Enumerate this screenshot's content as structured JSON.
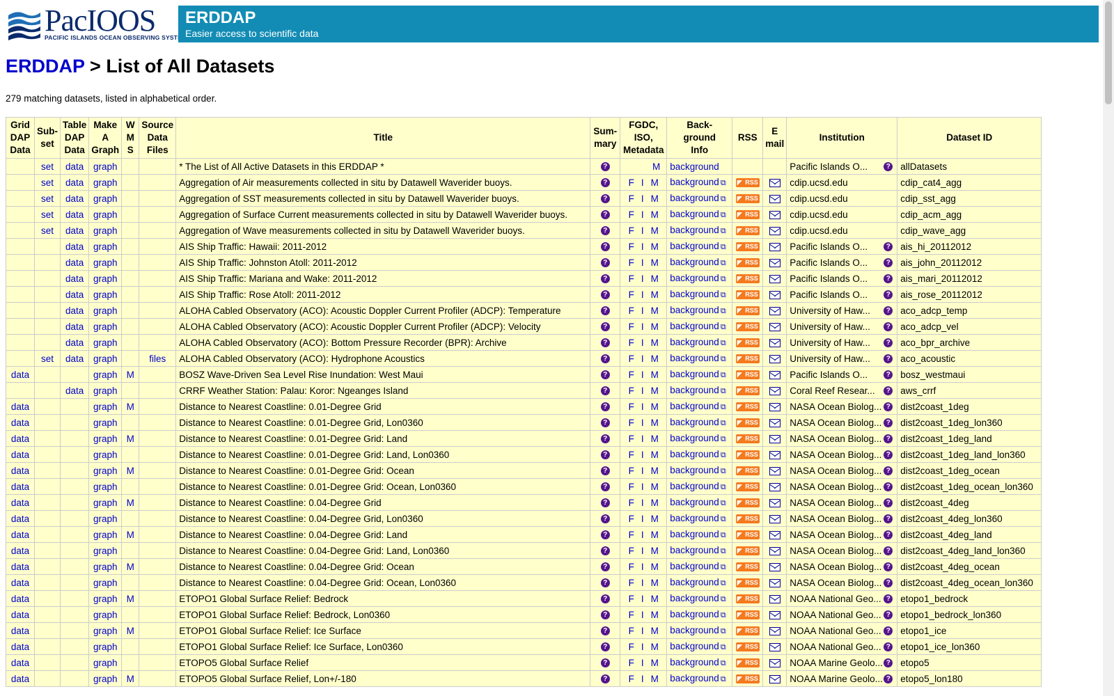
{
  "logo": {
    "name": "PacIOOS",
    "subtitle": "PACIFIC ISLANDS OCEAN OBSERVING SYSTEM"
  },
  "banner": {
    "title": "ERDDAP",
    "subtitle": "Easier access to scientific data"
  },
  "breadcrumb": {
    "home": "ERDDAP",
    "separator": " > ",
    "page": "List of All Datasets"
  },
  "count_text": "279 matching datasets, listed in alphabetical order.",
  "columns": {
    "griddap": [
      "Grid",
      "DAP",
      "Data"
    ],
    "subset": [
      "Sub-",
      "set"
    ],
    "tabledap": [
      "Table",
      "DAP",
      "Data"
    ],
    "graph": [
      "Make",
      "A",
      "Graph"
    ],
    "wms": [
      "W",
      "M",
      "S"
    ],
    "files": [
      "Source",
      "Data",
      "Files"
    ],
    "title": [
      "Title"
    ],
    "summary": [
      "Sum-",
      "mary"
    ],
    "metadata": [
      "FGDC,",
      "ISO,",
      "Metadata"
    ],
    "info": [
      "Back-",
      "ground",
      "Info"
    ],
    "rss": [
      "RSS"
    ],
    "email": [
      "E",
      "mail"
    ],
    "institution": [
      "Institution"
    ],
    "id": [
      "Dataset ID"
    ]
  },
  "rows": [
    {
      "grid": "",
      "subset": "set",
      "table": "data",
      "graph": "graph",
      "wms": "",
      "files": "",
      "title": "* The List of All Active Datasets in this ERDDAP *",
      "f": "",
      "i": "",
      "m": "M",
      "bg": "background",
      "ext": false,
      "rss": false,
      "mail": false,
      "inst": "Pacific Islands O...",
      "id": "allDatasets"
    },
    {
      "grid": "",
      "subset": "set",
      "table": "data",
      "graph": "graph",
      "wms": "",
      "files": "",
      "title": "Aggregation of Air measurements collected in situ by Datawell Waverider buoys.",
      "f": "F",
      "i": "I",
      "m": "M",
      "bg": "background",
      "ext": true,
      "rss": true,
      "mail": true,
      "inst": "cdip.ucsd.edu",
      "noq": true,
      "id": "cdip_cat4_agg"
    },
    {
      "grid": "",
      "subset": "set",
      "table": "data",
      "graph": "graph",
      "wms": "",
      "files": "",
      "title": "Aggregation of SST measurements collected in situ by Datawell Waverider buoys.",
      "f": "F",
      "i": "I",
      "m": "M",
      "bg": "background",
      "ext": true,
      "rss": true,
      "mail": true,
      "inst": "cdip.ucsd.edu",
      "noq": true,
      "id": "cdip_sst_agg"
    },
    {
      "grid": "",
      "subset": "set",
      "table": "data",
      "graph": "graph",
      "wms": "",
      "files": "",
      "title": "Aggregation of Surface Current measurements collected in situ by Datawell Waverider buoys.",
      "f": "F",
      "i": "I",
      "m": "M",
      "bg": "background",
      "ext": true,
      "rss": true,
      "mail": true,
      "inst": "cdip.ucsd.edu",
      "noq": true,
      "id": "cdip_acm_agg"
    },
    {
      "grid": "",
      "subset": "set",
      "table": "data",
      "graph": "graph",
      "wms": "",
      "files": "",
      "title": "Aggregation of Wave measurements collected in situ by Datawell Waverider buoys.",
      "f": "F",
      "i": "I",
      "m": "M",
      "bg": "background",
      "ext": true,
      "rss": true,
      "mail": true,
      "inst": "cdip.ucsd.edu",
      "noq": true,
      "id": "cdip_wave_agg"
    },
    {
      "grid": "",
      "subset": "",
      "table": "data",
      "graph": "graph",
      "wms": "",
      "files": "",
      "title": "AIS Ship Traffic: Hawaii: 2011-2012",
      "f": "F",
      "i": "I",
      "m": "M",
      "bg": "background",
      "ext": true,
      "rss": true,
      "mail": true,
      "inst": "Pacific Islands O...",
      "id": "ais_hi_20112012"
    },
    {
      "grid": "",
      "subset": "",
      "table": "data",
      "graph": "graph",
      "wms": "",
      "files": "",
      "title": "AIS Ship Traffic: Johnston Atoll: 2011-2012",
      "f": "F",
      "i": "I",
      "m": "M",
      "bg": "background",
      "ext": true,
      "rss": true,
      "mail": true,
      "inst": "Pacific Islands O...",
      "id": "ais_john_20112012"
    },
    {
      "grid": "",
      "subset": "",
      "table": "data",
      "graph": "graph",
      "wms": "",
      "files": "",
      "title": "AIS Ship Traffic: Mariana and Wake: 2011-2012",
      "f": "F",
      "i": "I",
      "m": "M",
      "bg": "background",
      "ext": true,
      "rss": true,
      "mail": true,
      "inst": "Pacific Islands O...",
      "id": "ais_mari_20112012"
    },
    {
      "grid": "",
      "subset": "",
      "table": "data",
      "graph": "graph",
      "wms": "",
      "files": "",
      "title": "AIS Ship Traffic: Rose Atoll: 2011-2012",
      "f": "F",
      "i": "I",
      "m": "M",
      "bg": "background",
      "ext": true,
      "rss": true,
      "mail": true,
      "inst": "Pacific Islands O...",
      "id": "ais_rose_20112012"
    },
    {
      "grid": "",
      "subset": "",
      "table": "data",
      "graph": "graph",
      "wms": "",
      "files": "",
      "title": "ALOHA Cabled Observatory (ACO): Acoustic Doppler Current Profiler (ADCP): Temperature",
      "f": "F",
      "i": "I",
      "m": "M",
      "bg": "background",
      "ext": true,
      "rss": true,
      "mail": true,
      "inst": "University of Haw...",
      "id": "aco_adcp_temp"
    },
    {
      "grid": "",
      "subset": "",
      "table": "data",
      "graph": "graph",
      "wms": "",
      "files": "",
      "title": "ALOHA Cabled Observatory (ACO): Acoustic Doppler Current Profiler (ADCP): Velocity",
      "f": "F",
      "i": "I",
      "m": "M",
      "bg": "background",
      "ext": true,
      "rss": true,
      "mail": true,
      "inst": "University of Haw...",
      "id": "aco_adcp_vel"
    },
    {
      "grid": "",
      "subset": "",
      "table": "data",
      "graph": "graph",
      "wms": "",
      "files": "",
      "title": "ALOHA Cabled Observatory (ACO): Bottom Pressure Recorder (BPR): Archive",
      "f": "F",
      "i": "I",
      "m": "M",
      "bg": "background",
      "ext": true,
      "rss": true,
      "mail": true,
      "inst": "University of Haw...",
      "id": "aco_bpr_archive"
    },
    {
      "grid": "",
      "subset": "set",
      "table": "data",
      "graph": "graph",
      "wms": "",
      "files": "files",
      "title": "ALOHA Cabled Observatory (ACO): Hydrophone Acoustics",
      "f": "F",
      "i": "I",
      "m": "M",
      "bg": "background",
      "ext": true,
      "rss": true,
      "mail": true,
      "inst": "University of Haw...",
      "id": "aco_acoustic"
    },
    {
      "grid": "data",
      "subset": "",
      "table": "",
      "graph": "graph",
      "wms": "M",
      "files": "",
      "title": "BOSZ Wave-Driven Sea Level Rise Inundation: West Maui",
      "f": "F",
      "i": "I",
      "m": "M",
      "bg": "background",
      "ext": true,
      "rss": true,
      "mail": true,
      "inst": "Pacific Islands O...",
      "id": "bosz_westmaui"
    },
    {
      "grid": "",
      "subset": "",
      "table": "data",
      "graph": "graph",
      "wms": "",
      "files": "",
      "title": "CRRF Weather Station: Palau: Koror: Ngeanges Island",
      "f": "F",
      "i": "I",
      "m": "M",
      "bg": "background",
      "ext": true,
      "rss": true,
      "mail": true,
      "inst": "Coral Reef Resear...",
      "id": "aws_crrf"
    },
    {
      "grid": "data",
      "subset": "",
      "table": "",
      "graph": "graph",
      "wms": "M",
      "files": "",
      "title": "Distance to Nearest Coastline: 0.01-Degree Grid",
      "f": "F",
      "i": "I",
      "m": "M",
      "bg": "background",
      "ext": true,
      "rss": true,
      "mail": true,
      "inst": "NASA Ocean Biolog...",
      "id": "dist2coast_1deg"
    },
    {
      "grid": "data",
      "subset": "",
      "table": "",
      "graph": "graph",
      "wms": "",
      "files": "",
      "title": "Distance to Nearest Coastline: 0.01-Degree Grid, Lon0360",
      "f": "F",
      "i": "I",
      "m": "M",
      "bg": "background",
      "ext": true,
      "rss": true,
      "mail": true,
      "inst": "NASA Ocean Biolog...",
      "id": "dist2coast_1deg_lon360"
    },
    {
      "grid": "data",
      "subset": "",
      "table": "",
      "graph": "graph",
      "wms": "M",
      "files": "",
      "title": "Distance to Nearest Coastline: 0.01-Degree Grid: Land",
      "f": "F",
      "i": "I",
      "m": "M",
      "bg": "background",
      "ext": true,
      "rss": true,
      "mail": true,
      "inst": "NASA Ocean Biolog...",
      "id": "dist2coast_1deg_land"
    },
    {
      "grid": "data",
      "subset": "",
      "table": "",
      "graph": "graph",
      "wms": "",
      "files": "",
      "title": "Distance to Nearest Coastline: 0.01-Degree Grid: Land, Lon0360",
      "f": "F",
      "i": "I",
      "m": "M",
      "bg": "background",
      "ext": true,
      "rss": true,
      "mail": true,
      "inst": "NASA Ocean Biolog...",
      "id": "dist2coast_1deg_land_lon360"
    },
    {
      "grid": "data",
      "subset": "",
      "table": "",
      "graph": "graph",
      "wms": "M",
      "files": "",
      "title": "Distance to Nearest Coastline: 0.01-Degree Grid: Ocean",
      "f": "F",
      "i": "I",
      "m": "M",
      "bg": "background",
      "ext": true,
      "rss": true,
      "mail": true,
      "inst": "NASA Ocean Biolog...",
      "id": "dist2coast_1deg_ocean"
    },
    {
      "grid": "data",
      "subset": "",
      "table": "",
      "graph": "graph",
      "wms": "",
      "files": "",
      "title": "Distance to Nearest Coastline: 0.01-Degree Grid: Ocean, Lon0360",
      "f": "F",
      "i": "I",
      "m": "M",
      "bg": "background",
      "ext": true,
      "rss": true,
      "mail": true,
      "inst": "NASA Ocean Biolog...",
      "id": "dist2coast_1deg_ocean_lon360"
    },
    {
      "grid": "data",
      "subset": "",
      "table": "",
      "graph": "graph",
      "wms": "M",
      "files": "",
      "title": "Distance to Nearest Coastline: 0.04-Degree Grid",
      "f": "F",
      "i": "I",
      "m": "M",
      "bg": "background",
      "ext": true,
      "rss": true,
      "mail": true,
      "inst": "NASA Ocean Biolog...",
      "id": "dist2coast_4deg"
    },
    {
      "grid": "data",
      "subset": "",
      "table": "",
      "graph": "graph",
      "wms": "",
      "files": "",
      "title": "Distance to Nearest Coastline: 0.04-Degree Grid, Lon0360",
      "f": "F",
      "i": "I",
      "m": "M",
      "bg": "background",
      "ext": true,
      "rss": true,
      "mail": true,
      "inst": "NASA Ocean Biolog...",
      "id": "dist2coast_4deg_lon360"
    },
    {
      "grid": "data",
      "subset": "",
      "table": "",
      "graph": "graph",
      "wms": "M",
      "files": "",
      "title": "Distance to Nearest Coastline: 0.04-Degree Grid: Land",
      "f": "F",
      "i": "I",
      "m": "M",
      "bg": "background",
      "ext": true,
      "rss": true,
      "mail": true,
      "inst": "NASA Ocean Biolog...",
      "id": "dist2coast_4deg_land"
    },
    {
      "grid": "data",
      "subset": "",
      "table": "",
      "graph": "graph",
      "wms": "",
      "files": "",
      "title": "Distance to Nearest Coastline: 0.04-Degree Grid: Land, Lon0360",
      "f": "F",
      "i": "I",
      "m": "M",
      "bg": "background",
      "ext": true,
      "rss": true,
      "mail": true,
      "inst": "NASA Ocean Biolog...",
      "id": "dist2coast_4deg_land_lon360"
    },
    {
      "grid": "data",
      "subset": "",
      "table": "",
      "graph": "graph",
      "wms": "M",
      "files": "",
      "title": "Distance to Nearest Coastline: 0.04-Degree Grid: Ocean",
      "f": "F",
      "i": "I",
      "m": "M",
      "bg": "background",
      "ext": true,
      "rss": true,
      "mail": true,
      "inst": "NASA Ocean Biolog...",
      "id": "dist2coast_4deg_ocean"
    },
    {
      "grid": "data",
      "subset": "",
      "table": "",
      "graph": "graph",
      "wms": "",
      "files": "",
      "title": "Distance to Nearest Coastline: 0.04-Degree Grid: Ocean, Lon0360",
      "f": "F",
      "i": "I",
      "m": "M",
      "bg": "background",
      "ext": true,
      "rss": true,
      "mail": true,
      "inst": "NASA Ocean Biolog...",
      "id": "dist2coast_4deg_ocean_lon360"
    },
    {
      "grid": "data",
      "subset": "",
      "table": "",
      "graph": "graph",
      "wms": "M",
      "files": "",
      "title": "ETOPO1 Global Surface Relief: Bedrock",
      "f": "F",
      "i": "I",
      "m": "M",
      "bg": "background",
      "ext": true,
      "rss": true,
      "mail": true,
      "inst": "NOAA National Geo...",
      "id": "etopo1_bedrock"
    },
    {
      "grid": "data",
      "subset": "",
      "table": "",
      "graph": "graph",
      "wms": "",
      "files": "",
      "title": "ETOPO1 Global Surface Relief: Bedrock, Lon0360",
      "f": "F",
      "i": "I",
      "m": "M",
      "bg": "background",
      "ext": true,
      "rss": true,
      "mail": true,
      "inst": "NOAA National Geo...",
      "id": "etopo1_bedrock_lon360"
    },
    {
      "grid": "data",
      "subset": "",
      "table": "",
      "graph": "graph",
      "wms": "M",
      "files": "",
      "title": "ETOPO1 Global Surface Relief: Ice Surface",
      "f": "F",
      "i": "I",
      "m": "M",
      "bg": "background",
      "ext": true,
      "rss": true,
      "mail": true,
      "inst": "NOAA National Geo...",
      "id": "etopo1_ice"
    },
    {
      "grid": "data",
      "subset": "",
      "table": "",
      "graph": "graph",
      "wms": "",
      "files": "",
      "title": "ETOPO1 Global Surface Relief: Ice Surface, Lon0360",
      "f": "F",
      "i": "I",
      "m": "M",
      "bg": "background",
      "ext": true,
      "rss": true,
      "mail": true,
      "inst": "NOAA National Geo...",
      "id": "etopo1_ice_lon360"
    },
    {
      "grid": "data",
      "subset": "",
      "table": "",
      "graph": "graph",
      "wms": "",
      "files": "",
      "title": "ETOPO5 Global Surface Relief",
      "f": "F",
      "i": "I",
      "m": "M",
      "bg": "background",
      "ext": true,
      "rss": true,
      "mail": true,
      "inst": "NOAA Marine Geolo...",
      "id": "etopo5"
    },
    {
      "grid": "data",
      "subset": "",
      "table": "",
      "graph": "graph",
      "wms": "M",
      "files": "",
      "title": "ETOPO5 Global Surface Relief, Lon+/-180",
      "f": "F",
      "i": "I",
      "m": "M",
      "bg": "background",
      "ext": true,
      "rss": true,
      "mail": true,
      "inst": "NOAA Marine Geolo...",
      "id": "etopo5_lon180"
    }
  ],
  "icons": {
    "summary": "question-icon",
    "rss": "rss-icon",
    "email": "envelope-icon",
    "external": "external-link-icon"
  },
  "colors": {
    "banner": "#128cb4",
    "table_bg": "#ffffcc",
    "link": "#0000cc",
    "info_icon": "#55158c",
    "rss": "#f47a20"
  }
}
